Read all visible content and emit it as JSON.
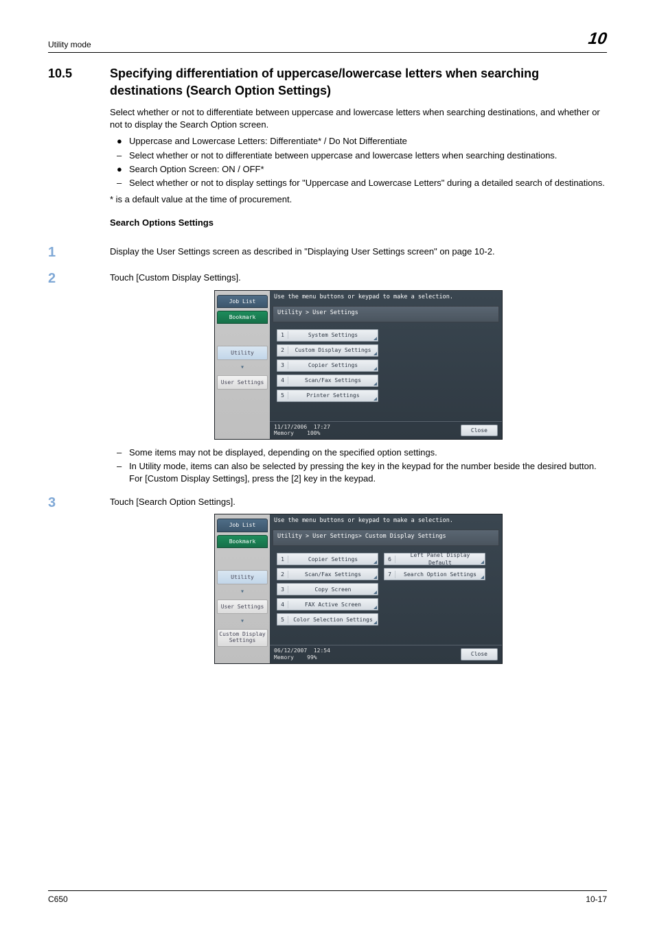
{
  "header": {
    "left": "Utility mode",
    "chapter": "10"
  },
  "section": {
    "num": "10.5",
    "title": "Specifying differentiation of uppercase/lowercase letters when searching destinations (Search Option Settings)",
    "intro": "Select whether or not to differentiate between uppercase and lowercase letters when searching destinations, and whether or not to display the Search Option screen.",
    "bullets": [
      {
        "marker": "●",
        "text": "Uppercase and Lowercase Letters: Differentiate* / Do Not Differentiate"
      },
      {
        "marker": "–",
        "text": "Select whether or not to differentiate between uppercase and lowercase letters when searching destinations."
      },
      {
        "marker": "●",
        "text": "Search Option Screen: ON / OFF*"
      },
      {
        "marker": "–",
        "text": "Select whether or not to display settings for \"Uppercase and Lowercase Letters\" during a detailed search of destinations."
      }
    ],
    "note": "* is a default value at the time of procurement."
  },
  "procedure": {
    "heading": "Search Options Settings",
    "steps": [
      {
        "n": "1",
        "text": "Display the User Settings screen as described in \"Displaying User Settings screen\" on page 10-2."
      },
      {
        "n": "2",
        "text": "Touch [Custom Display Settings]."
      },
      {
        "n": "3",
        "text": "Touch [Search Option Settings]."
      }
    ],
    "step2_notes": [
      {
        "marker": "–",
        "text": "Some items may not be displayed, depending on the specified option settings."
      },
      {
        "marker": "–",
        "text": "In Utility mode, items can also be selected by pressing the key in the keypad for the number beside the desired button. For [Custom Display Settings], press the [2] key in the keypad."
      }
    ]
  },
  "lcd1": {
    "instruction": "Use the menu buttons or keypad to make a selection.",
    "breadcrumb": "Utility > User Settings",
    "tabs": {
      "jobList": "Job List",
      "bookmark": "Bookmark"
    },
    "nav": {
      "utility": "Utility",
      "userSettings": "User Settings"
    },
    "menu": [
      {
        "n": "1",
        "label": "System Settings"
      },
      {
        "n": "2",
        "label": "Custom Display Settings"
      },
      {
        "n": "3",
        "label": "Copier Settings"
      },
      {
        "n": "4",
        "label": "Scan/Fax Settings"
      },
      {
        "n": "5",
        "label": "Printer Settings"
      }
    ],
    "footer": {
      "date": "11/17/2006",
      "time": "17:27",
      "memLabel": "Memory",
      "mem": "100%",
      "close": "Close"
    }
  },
  "lcd2": {
    "instruction": "Use the menu buttons or keypad to make a selection.",
    "breadcrumb": "Utility > User Settings> Custom Display Settings",
    "tabs": {
      "jobList": "Job List",
      "bookmark": "Bookmark"
    },
    "nav": {
      "utility": "Utility",
      "userSettings": "User Settings",
      "custom": "Custom Display Settings"
    },
    "menuLeft": [
      {
        "n": "1",
        "label": "Copier Settings"
      },
      {
        "n": "2",
        "label": "Scan/Fax Settings"
      },
      {
        "n": "3",
        "label": "Copy Screen"
      },
      {
        "n": "4",
        "label": "FAX Active Screen"
      },
      {
        "n": "5",
        "label": "Color Selection Settings"
      }
    ],
    "menuRight": [
      {
        "n": "6",
        "label": "Left Panel Display Default"
      },
      {
        "n": "7",
        "label": "Search Option Settings"
      }
    ],
    "footer": {
      "date": "06/12/2007",
      "time": "12:54",
      "memLabel": "Memory",
      "mem": "99%",
      "close": "Close"
    }
  },
  "footer": {
    "left": "C650",
    "right": "10-17"
  }
}
